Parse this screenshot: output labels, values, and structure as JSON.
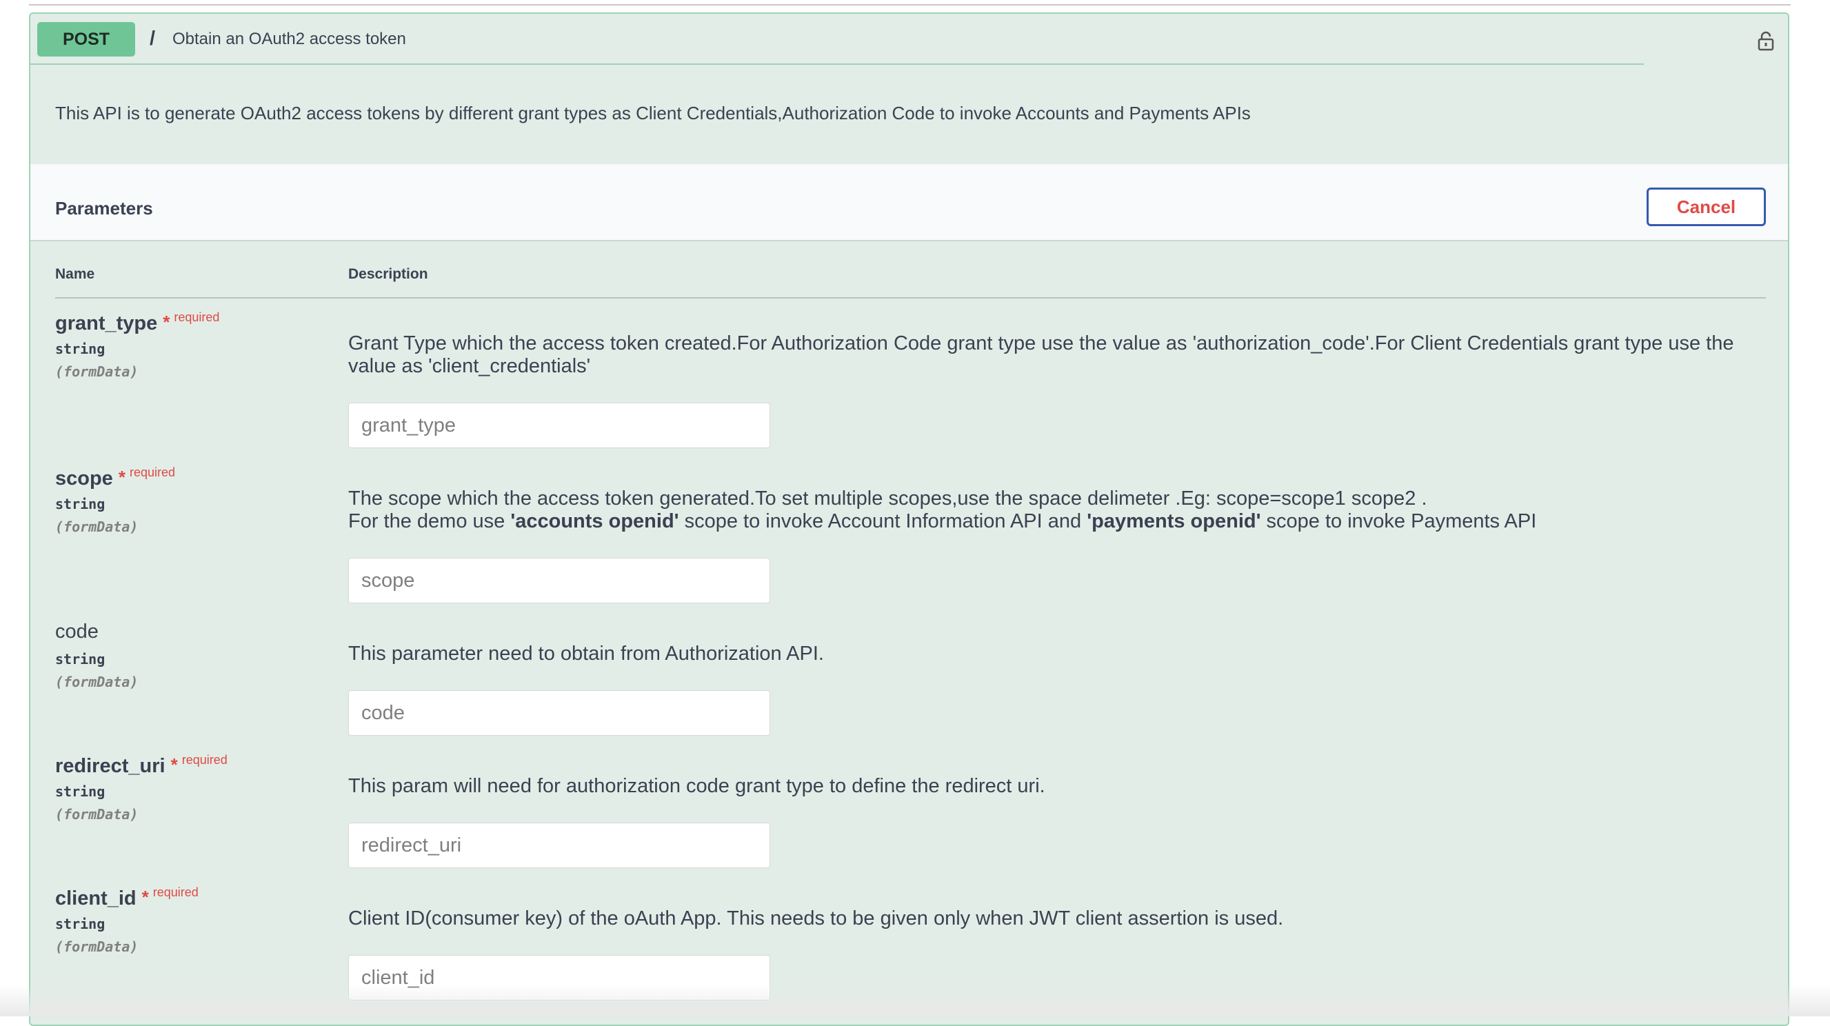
{
  "operation": {
    "method": "POST",
    "path": "/",
    "summary": "Obtain an OAuth2 access token",
    "description": "This API is to generate OAuth2 access tokens by different grant types as Client Credentials,Authorization Code to invoke Accounts and Payments APIs",
    "lock_icon": "lock-icon"
  },
  "parameters": {
    "title": "Parameters",
    "cancel_label": "Cancel",
    "col_name": "Name",
    "col_description": "Description",
    "required_star": "*",
    "required_label": "required",
    "items": [
      {
        "name": "grant_type",
        "required": true,
        "type": "string",
        "in": "(formData)",
        "description": "Grant Type which the access token created.For Authorization Code grant type use the value as 'authorization_code'.For Client Credentials grant type use the value as 'client_credentials'",
        "placeholder": "grant_type",
        "value": ""
      },
      {
        "name": "scope",
        "required": true,
        "type": "string",
        "in": "(formData)",
        "description_line1": "The scope which the access token generated.To set multiple scopes,use the space delimeter .Eg: scope=scope1 scope2 .",
        "description_line2_a": "For the demo use ",
        "description_line2_b": "'accounts openid'",
        "description_line2_c": " scope to invoke Account Information API and ",
        "description_line2_d": "'payments openid'",
        "description_line2_e": " scope to invoke Payments API",
        "placeholder": "scope",
        "value": ""
      },
      {
        "name": "code",
        "required": false,
        "type": "string",
        "in": "(formData)",
        "description": "This parameter need to obtain from Authorization API.",
        "placeholder": "code",
        "value": ""
      },
      {
        "name": "redirect_uri",
        "required": true,
        "type": "string",
        "in": "(formData)",
        "description": "This param will need for authorization code grant type to define the redirect uri.",
        "placeholder": "redirect_uri",
        "value": ""
      },
      {
        "name": "client_id",
        "required": true,
        "type": "string",
        "in": "(formData)",
        "description": "Client ID(consumer key) of the oAuth App. This needs to be given only when JWT client assertion is used.",
        "placeholder": "client_id",
        "value": ""
      }
    ]
  },
  "colors": {
    "post_method": "#6fc596",
    "block_background": "#e2ede7",
    "block_border": "#9fd4b6",
    "required": "#e04a45",
    "cancel_border": "#355bb0"
  }
}
